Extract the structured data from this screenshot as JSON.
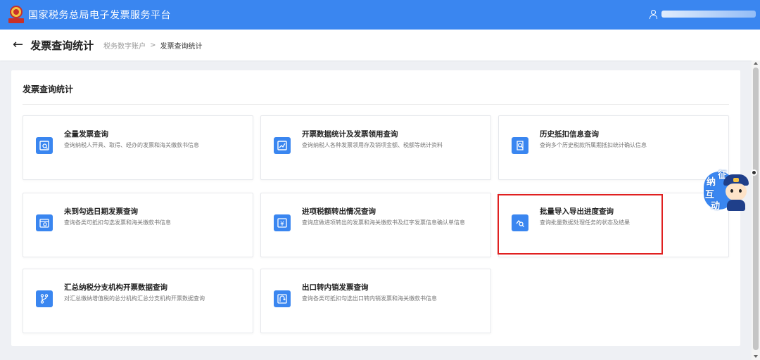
{
  "header": {
    "app_title": "国家税务总局电子发票服务平台",
    "brand_color": "#3a86f0"
  },
  "subheader": {
    "back_icon": "arrow-left-icon",
    "page_title": "发票查询统计",
    "breadcrumb": {
      "parent": "税务数字账户",
      "separator": ">",
      "current": "发票查询统计"
    }
  },
  "panel": {
    "title": "发票查询统计"
  },
  "cards": [
    {
      "title": "全量发票查询",
      "desc": "查询纳税人开具、取得、经办的发票和海关缴款书信息",
      "icon": "invoice-search-icon"
    },
    {
      "title": "开票数据统计及发票领用查询",
      "desc": "查询纳税人各种发票领用存及销项金额、税额等统计资料",
      "icon": "chart-trend-icon"
    },
    {
      "title": "历史抵扣信息查询",
      "desc": "查询多个历史税款所属期抵扣统计确认信息",
      "icon": "history-search-icon"
    },
    {
      "title": "未到勾选日期发票查询",
      "desc": "查询各类可抵扣勾选发票和海关缴款书信息",
      "icon": "calendar-clock-icon"
    },
    {
      "title": "进项税额转出情况查询",
      "desc": "查询应做进项转出的发票和海关缴款书及红字发票信息确认单信息",
      "icon": "yuan-transfer-icon"
    },
    {
      "title": "批量导入导出进度查询",
      "desc": "查询批量数据处理任务的状态及结果",
      "icon": "progress-search-icon"
    },
    {
      "title": "汇总纳税分支机构开票数据查询",
      "desc": "对汇总缴纳增值税的总分机构汇总分支机构开票数据查询",
      "icon": "branch-icon"
    },
    {
      "title": "出口转内销发票查询",
      "desc": "查询各类可抵扣勾选出口转内销发票和海关缴款书信息",
      "icon": "export-return-icon"
    }
  ],
  "mascot": {
    "chars": [
      "征",
      "纳",
      "互",
      "动"
    ]
  }
}
